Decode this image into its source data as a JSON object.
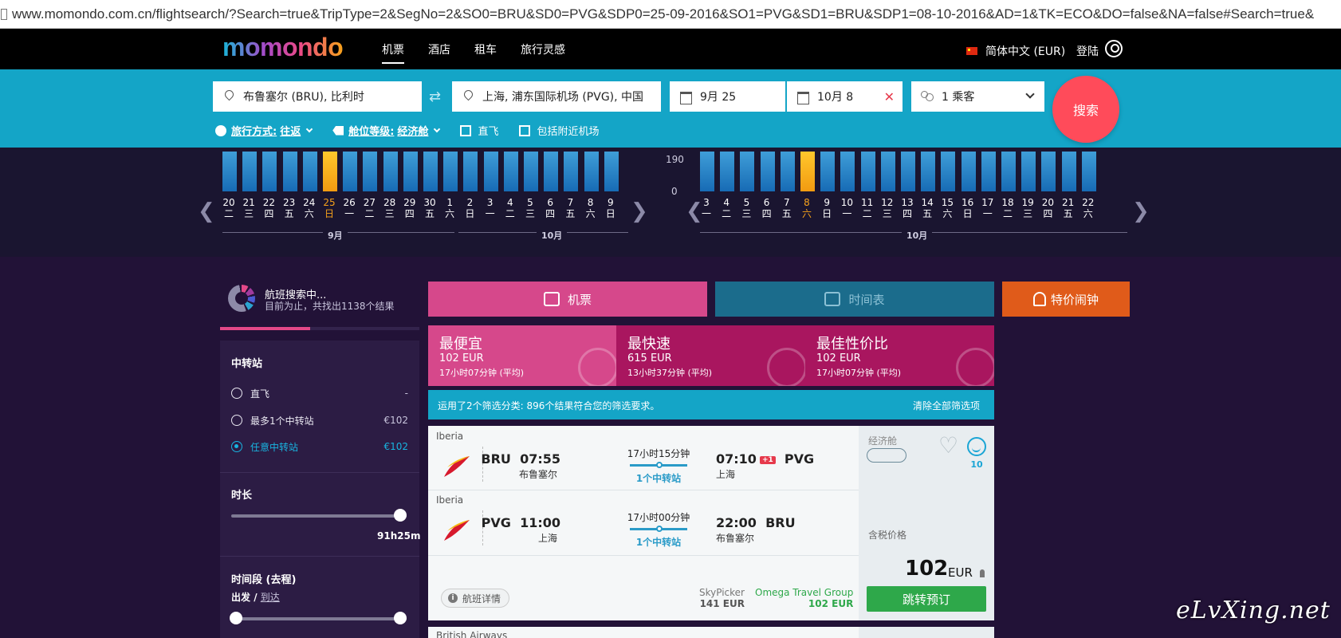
{
  "browser": {
    "url": "www.momondo.com.cn/flightsearch/?Search=true&TripType=2&SegNo=2&SO0=BRU&SD0=PVG&SDP0=25-09-2016&SO1=PVG&SD1=BRU&SDP1=08-10-2016&AD=1&TK=ECO&DO=false&NA=false#Search=true&"
  },
  "header": {
    "logo": "momondo",
    "nav": [
      "机票",
      "酒店",
      "租车",
      "旅行灵感"
    ],
    "language": "简体中文 (EUR)",
    "login": "登陆"
  },
  "search": {
    "origin": "布鲁塞尔 (BRU), 比利时",
    "destination": "上海, 浦东国际机场 (PVG), 中国",
    "depart_date": "9月 25",
    "return_date": "10月 8",
    "passengers": "1 乘客",
    "search_button": "搜索",
    "trip_type_label": "旅行方式:",
    "trip_type_value": "往返",
    "cabin_label": "舱位等级:",
    "cabin_value": "经济舱",
    "direct_label": "直飞",
    "nearby_label": "包括附近机场"
  },
  "calendar": {
    "axis_top": "190",
    "axis_zero": "0",
    "outbound": {
      "days": [
        {
          "d": "20",
          "w": "二"
        },
        {
          "d": "21",
          "w": "三"
        },
        {
          "d": "22",
          "w": "四"
        },
        {
          "d": "23",
          "w": "五"
        },
        {
          "d": "24",
          "w": "六"
        },
        {
          "d": "25",
          "w": "日"
        },
        {
          "d": "26",
          "w": "一"
        },
        {
          "d": "27",
          "w": "二"
        },
        {
          "d": "28",
          "w": "三"
        },
        {
          "d": "29",
          "w": "四"
        },
        {
          "d": "30",
          "w": "五"
        },
        {
          "d": "1",
          "w": "六"
        },
        {
          "d": "2",
          "w": "日"
        },
        {
          "d": "3",
          "w": "一"
        },
        {
          "d": "4",
          "w": "二"
        },
        {
          "d": "5",
          "w": "三"
        },
        {
          "d": "6",
          "w": "四"
        },
        {
          "d": "7",
          "w": "五"
        },
        {
          "d": "8",
          "w": "六"
        },
        {
          "d": "9",
          "w": "日"
        }
      ],
      "selected_index": 5,
      "month1": "9月",
      "month2": "10月"
    },
    "inbound": {
      "days": [
        {
          "d": "3",
          "w": "一"
        },
        {
          "d": "4",
          "w": "二"
        },
        {
          "d": "5",
          "w": "三"
        },
        {
          "d": "6",
          "w": "四"
        },
        {
          "d": "7",
          "w": "五"
        },
        {
          "d": "8",
          "w": "六"
        },
        {
          "d": "9",
          "w": "日"
        },
        {
          "d": "10",
          "w": "一"
        },
        {
          "d": "11",
          "w": "二"
        },
        {
          "d": "12",
          "w": "三"
        },
        {
          "d": "13",
          "w": "四"
        },
        {
          "d": "14",
          "w": "五"
        },
        {
          "d": "15",
          "w": "六"
        },
        {
          "d": "16",
          "w": "日"
        },
        {
          "d": "17",
          "w": "一"
        },
        {
          "d": "18",
          "w": "二"
        },
        {
          "d": "19",
          "w": "三"
        },
        {
          "d": "20",
          "w": "四"
        },
        {
          "d": "21",
          "w": "五"
        },
        {
          "d": "22",
          "w": "六"
        }
      ],
      "selected_index": 5,
      "month1": "10月"
    }
  },
  "status": {
    "title": "航班搜索中...",
    "subtitle": "目前为止，共找出1138个结果",
    "progress": 0.45
  },
  "filters": {
    "stops_title": "中转站",
    "stops": [
      {
        "label": "直飞",
        "price": "-",
        "selected": false
      },
      {
        "label": "最多1个中转站",
        "price": "€102",
        "selected": false
      },
      {
        "label": "任意中转站",
        "price": "€102",
        "selected": true
      }
    ],
    "duration_title": "时长",
    "duration_value": "91h25m",
    "timeslot_title": "时间段 (去程)",
    "timeslot_depart": "出发",
    "timeslot_sep": "/",
    "timeslot_arrive": "到达"
  },
  "tabs": {
    "flights": "机票",
    "schedule": "时间表",
    "alert": "特价闹钟"
  },
  "sort": [
    {
      "label": "最便宜",
      "price": "102 EUR",
      "duration": "17小时07分钟 (平均)"
    },
    {
      "label": "最快速",
      "price": "615 EUR",
      "duration": "13小时37分钟 (平均)"
    },
    {
      "label": "最佳性价比",
      "price": "102 EUR",
      "duration": "17小时07分钟 (平均)"
    }
  ],
  "notice": {
    "text": "运用了2个筛选分类: 896个结果符合您的筛选要求。",
    "clear": "清除全部筛选项"
  },
  "result": {
    "legs": [
      {
        "airline": "Iberia",
        "dep_code": "BRU",
        "dep_time": "07:55",
        "dep_city": "布鲁塞尔",
        "duration": "17小时15分钟",
        "stops": "1个中转站",
        "arr_time": "07:10",
        "arr_plus": "+1",
        "arr_code": "PVG",
        "arr_city": "上海"
      },
      {
        "airline": "Iberia",
        "dep_code": "PVG",
        "dep_time": "11:00",
        "dep_city": "上海",
        "duration": "17小时00分钟",
        "stops": "1个中转站",
        "arr_time": "22:00",
        "arr_code": "BRU",
        "arr_city": "布鲁塞尔"
      }
    ],
    "details": "航班详情",
    "provider1_name": "SkyPicker",
    "provider1_price": "141 EUR",
    "provider2_name": "Omega Travel Group",
    "provider2_price": "102 EUR",
    "cabin": "经济舱",
    "score": "10",
    "price_label": "含税价格",
    "price": "102",
    "currency": "EUR",
    "book": "跳转预订"
  },
  "next_result": {
    "airline": "British Airways"
  },
  "watermark": "eLvXing.net",
  "colors": {
    "brand_cyan": "#14a5c7",
    "pink": "#d6488b",
    "magenta": "#a9165f",
    "orange": "#e05b1a",
    "green": "#2ea84a",
    "search_red": "#ff4b5a"
  }
}
